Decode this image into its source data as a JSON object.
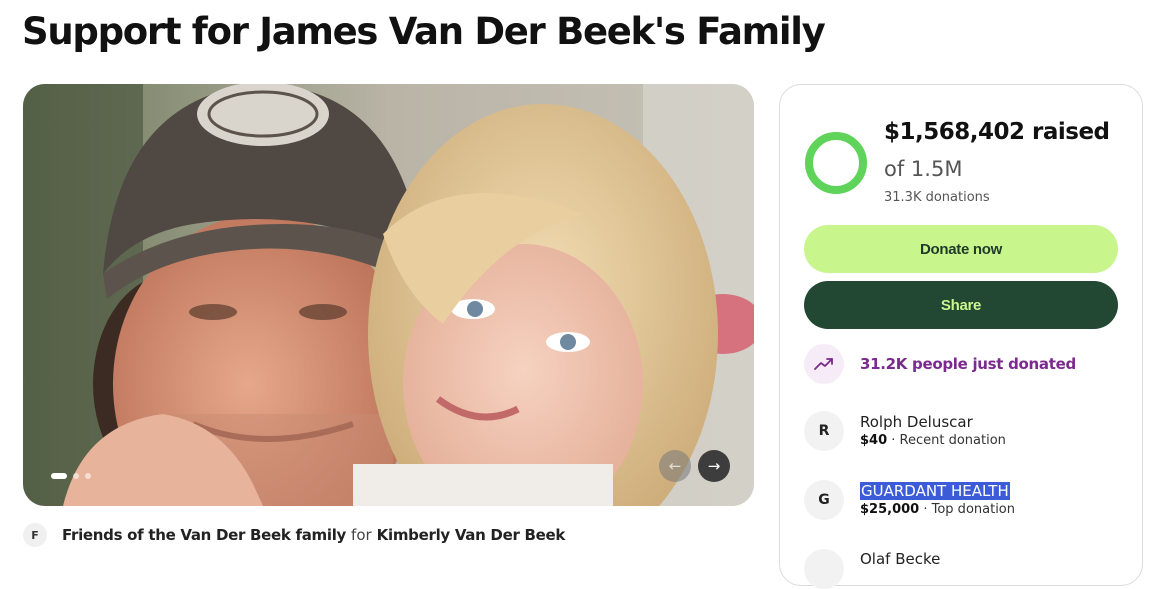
{
  "page": {
    "title": "Support for James Van Der Beek's Family"
  },
  "hero": {
    "prev_icon": "arrow-left-icon",
    "next_icon": "arrow-right-icon",
    "prev_glyph": "←",
    "next_glyph": "→"
  },
  "organizer": {
    "avatar_initial": "F",
    "name": "Friends of the Van Der Beek family",
    "connector": "for",
    "beneficiary": "Kimberly Van Der Beek"
  },
  "progress": {
    "raised": "$1,568,402 raised",
    "goal": "of 1.5M",
    "donations": "31.3K donations",
    "fraction": 1.0,
    "ring_color": "#5fd35a"
  },
  "actions": {
    "donate_label": "Donate now",
    "share_label": "Share"
  },
  "trend": {
    "icon": "trending-up-icon",
    "text": "31.2K people just donated"
  },
  "donors": [
    {
      "initial": "R",
      "name": "Rolph Deluscar",
      "amount": "$40",
      "meta": " · Recent donation"
    },
    {
      "initial": "G",
      "name": "GUARDANT HEALTH",
      "amount": "$25,000",
      "meta": " · Top donation"
    },
    {
      "initial": "",
      "name": "Olaf Becke",
      "amount": "",
      "meta": ""
    }
  ],
  "colors": {
    "donate_bg": "#c9f58d",
    "share_bg": "#224733",
    "trend_text": "#7b2a8e",
    "selection": "#3b5bd8"
  }
}
